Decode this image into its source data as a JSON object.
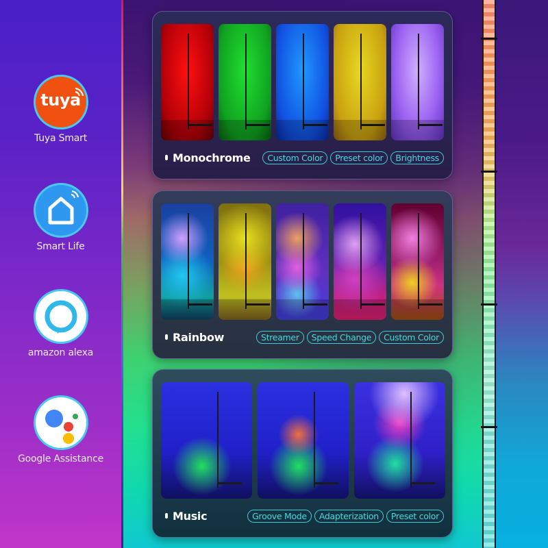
{
  "apps": [
    {
      "name": "Tuya Smart",
      "icon": "tuya-logo-icon",
      "logo_text": "tuya",
      "color": "#f05010"
    },
    {
      "name": "Smart Life",
      "icon": "smart-life-house-icon",
      "color": "#2e98f0"
    },
    {
      "name": "amazon alexa",
      "icon": "alexa-ring-icon",
      "color": "#30b8e8"
    },
    {
      "name": "Google Assistance",
      "icon": "google-assistant-dots-icon",
      "colors": [
        "#4285f4",
        "#ea4335",
        "#fbbc05",
        "#34a853"
      ]
    }
  ],
  "modes": [
    {
      "title": "Monochrome",
      "chips": [
        "Custom Color",
        "Preset color",
        "Brightness"
      ],
      "thumbnails": [
        {
          "label": "red",
          "color": "#e00010"
        },
        {
          "label": "green",
          "color": "#10c020"
        },
        {
          "label": "blue",
          "color": "#1060f0"
        },
        {
          "label": "yellow",
          "color": "#d8c010"
        },
        {
          "label": "purple",
          "color": "#a070f0"
        }
      ]
    },
    {
      "title": "Rainbow",
      "chips": [
        "Streamer",
        "Speed Change",
        "Custom Color"
      ],
      "thumbnails": [
        {
          "label": "blue-cyan",
          "colors": [
            "#1a40a0",
            "#d0a0ff",
            "#20c8f0",
            "#10a0a0"
          ]
        },
        {
          "label": "yellow-orange",
          "colors": [
            "#807010",
            "#e8e020",
            "#f0a020",
            "#c0c020"
          ]
        },
        {
          "label": "purple-orange",
          "colors": [
            "#4020a0",
            "#f0a060",
            "#e060e0",
            "#60c0f0"
          ]
        },
        {
          "label": "violet-pink",
          "colors": [
            "#3010a0",
            "#e0a0f0",
            "#d040c0",
            "#e02070"
          ]
        },
        {
          "label": "magenta-yellow",
          "colors": [
            "#600030",
            "#f080e0",
            "#d03080",
            "#f0d020"
          ]
        }
      ]
    },
    {
      "title": "Music",
      "chips": [
        "Groove Mode",
        "Adapterization",
        "Preset color"
      ],
      "thumbnails": [
        {
          "label": "music-scene-green",
          "colors": [
            "#2020d0",
            "#20e060"
          ]
        },
        {
          "label": "music-scene-rainbow",
          "colors": [
            "#2020d0",
            "#f07040",
            "#20e060"
          ]
        },
        {
          "label": "music-scene-pink",
          "colors": [
            "#3020d0",
            "#f040c0",
            "#20e0a0"
          ]
        }
      ]
    }
  ]
}
